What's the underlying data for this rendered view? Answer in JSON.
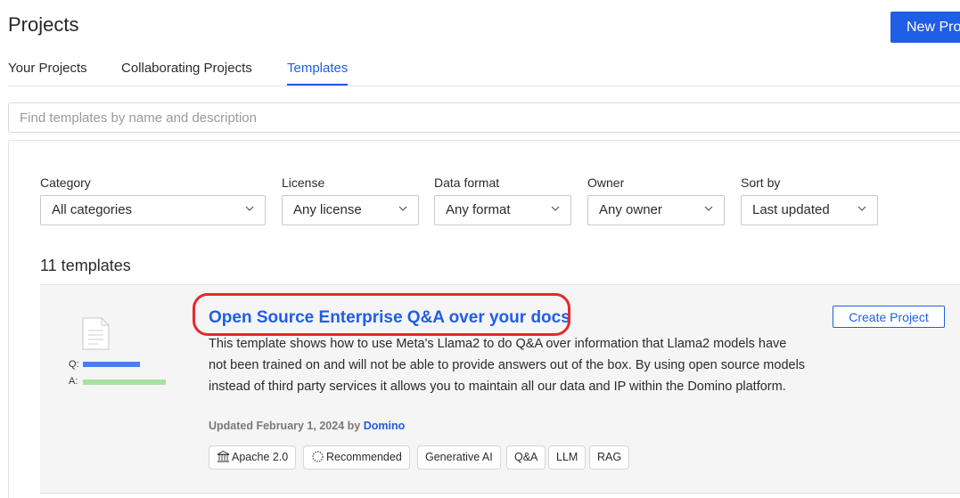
{
  "header": {
    "title": "Projects",
    "new_project_label": "New Proj"
  },
  "tabs": [
    {
      "label": "Your Projects",
      "active": false
    },
    {
      "label": "Collaborating Projects",
      "active": false
    },
    {
      "label": "Templates",
      "active": true
    }
  ],
  "search": {
    "placeholder": "Find templates by name and description",
    "value": ""
  },
  "filters": [
    {
      "label": "Category",
      "value": "All categories"
    },
    {
      "label": "License",
      "value": "Any license"
    },
    {
      "label": "Data format",
      "value": "Any format"
    },
    {
      "label": "Owner",
      "value": "Any owner"
    },
    {
      "label": "Sort by",
      "value": "Last updated"
    }
  ],
  "results": {
    "count_text": "11 templates"
  },
  "template_card": {
    "thumbnail": {
      "q_label": "Q:",
      "a_label": "A:",
      "q_color": "#4a7ef0",
      "a_color": "#a8e2a0"
    },
    "title": "Open Source Enterprise Q&A over your docs",
    "description": "This template shows how to use Meta's Llama2 to do Q&A over information that Llama2 models have not been trained on and will not be able to provide answers out of the box. By using open source models instead of third party services it allows you to maintain all our data and IP within the Domino platform.",
    "updated_prefix": "Updated February 1, 2024 by",
    "author": "Domino",
    "create_label": "Create Project",
    "tags": [
      {
        "label": "Apache 2.0",
        "icon": "bank-icon"
      },
      {
        "label": "Recommended",
        "icon": "badge-icon"
      },
      {
        "label": "Generative AI"
      },
      {
        "label": "Q&A"
      },
      {
        "label": "LLM"
      },
      {
        "label": "RAG"
      }
    ]
  },
  "colors": {
    "accent": "#1f5ee6",
    "highlight": "#e8272b"
  }
}
